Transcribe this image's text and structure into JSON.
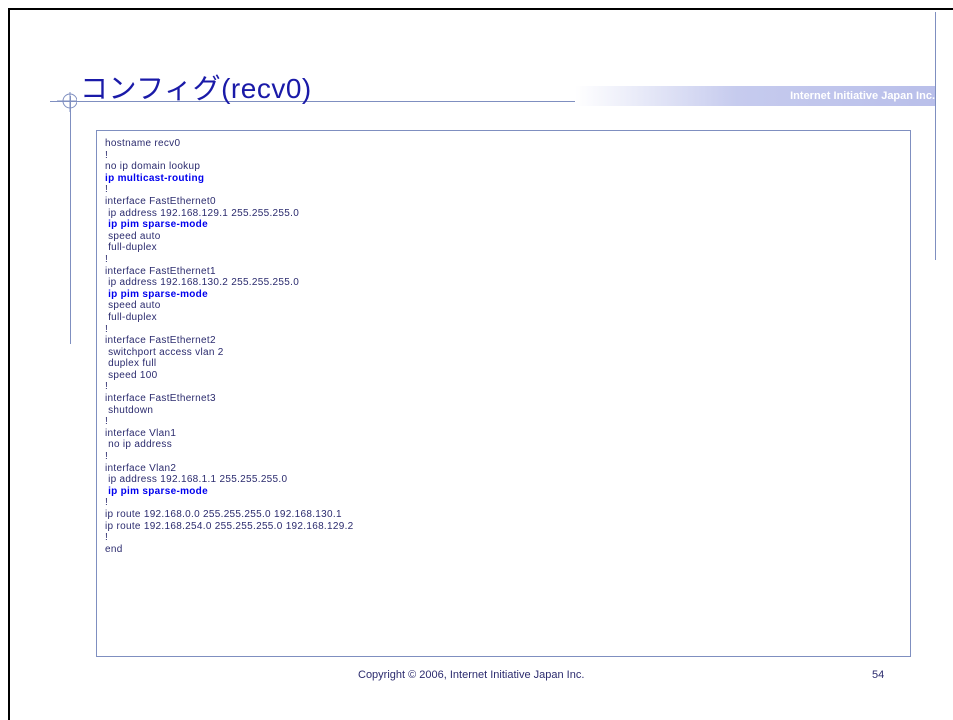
{
  "header": {
    "title": "コンフィグ(recv0)",
    "brand": "Internet Initiative Japan Inc."
  },
  "config": {
    "lines": [
      {
        "text": "hostname recv0",
        "highlight": false
      },
      {
        "text": "!",
        "highlight": false
      },
      {
        "text": "no ip domain lookup",
        "highlight": false
      },
      {
        "text": "ip multicast-routing",
        "highlight": true
      },
      {
        "text": "!",
        "highlight": false
      },
      {
        "text": "interface FastEthernet0",
        "highlight": false
      },
      {
        "text": " ip address 192.168.129.1 255.255.255.0",
        "highlight": false
      },
      {
        "text": " ip pim sparse-mode",
        "highlight": true
      },
      {
        "text": " speed auto",
        "highlight": false
      },
      {
        "text": " full-duplex",
        "highlight": false
      },
      {
        "text": "!",
        "highlight": false
      },
      {
        "text": "interface FastEthernet1",
        "highlight": false
      },
      {
        "text": " ip address 192.168.130.2 255.255.255.0",
        "highlight": false
      },
      {
        "text": " ip pim sparse-mode",
        "highlight": true
      },
      {
        "text": " speed auto",
        "highlight": false
      },
      {
        "text": " full-duplex",
        "highlight": false
      },
      {
        "text": "!",
        "highlight": false
      },
      {
        "text": "interface FastEthernet2",
        "highlight": false
      },
      {
        "text": " switchport access vlan 2",
        "highlight": false
      },
      {
        "text": " duplex full",
        "highlight": false
      },
      {
        "text": " speed 100",
        "highlight": false
      },
      {
        "text": "!",
        "highlight": false
      },
      {
        "text": "interface FastEthernet3",
        "highlight": false
      },
      {
        "text": " shutdown",
        "highlight": false
      },
      {
        "text": "!",
        "highlight": false
      },
      {
        "text": "interface Vlan1",
        "highlight": false
      },
      {
        "text": " no ip address",
        "highlight": false
      },
      {
        "text": "!",
        "highlight": false
      },
      {
        "text": "interface Vlan2",
        "highlight": false
      },
      {
        "text": " ip address 192.168.1.1 255.255.255.0",
        "highlight": false
      },
      {
        "text": " ip pim sparse-mode",
        "highlight": true
      },
      {
        "text": "!",
        "highlight": false
      },
      {
        "text": "ip route 192.168.0.0 255.255.255.0 192.168.130.1",
        "highlight": false
      },
      {
        "text": "ip route 192.168.254.0 255.255.255.0 192.168.129.2",
        "highlight": false
      },
      {
        "text": "!",
        "highlight": false
      },
      {
        "text": "end",
        "highlight": false
      }
    ]
  },
  "footer": {
    "copyright": "Copyright © 2006, Internet Initiative Japan Inc.",
    "page_number": "54"
  }
}
